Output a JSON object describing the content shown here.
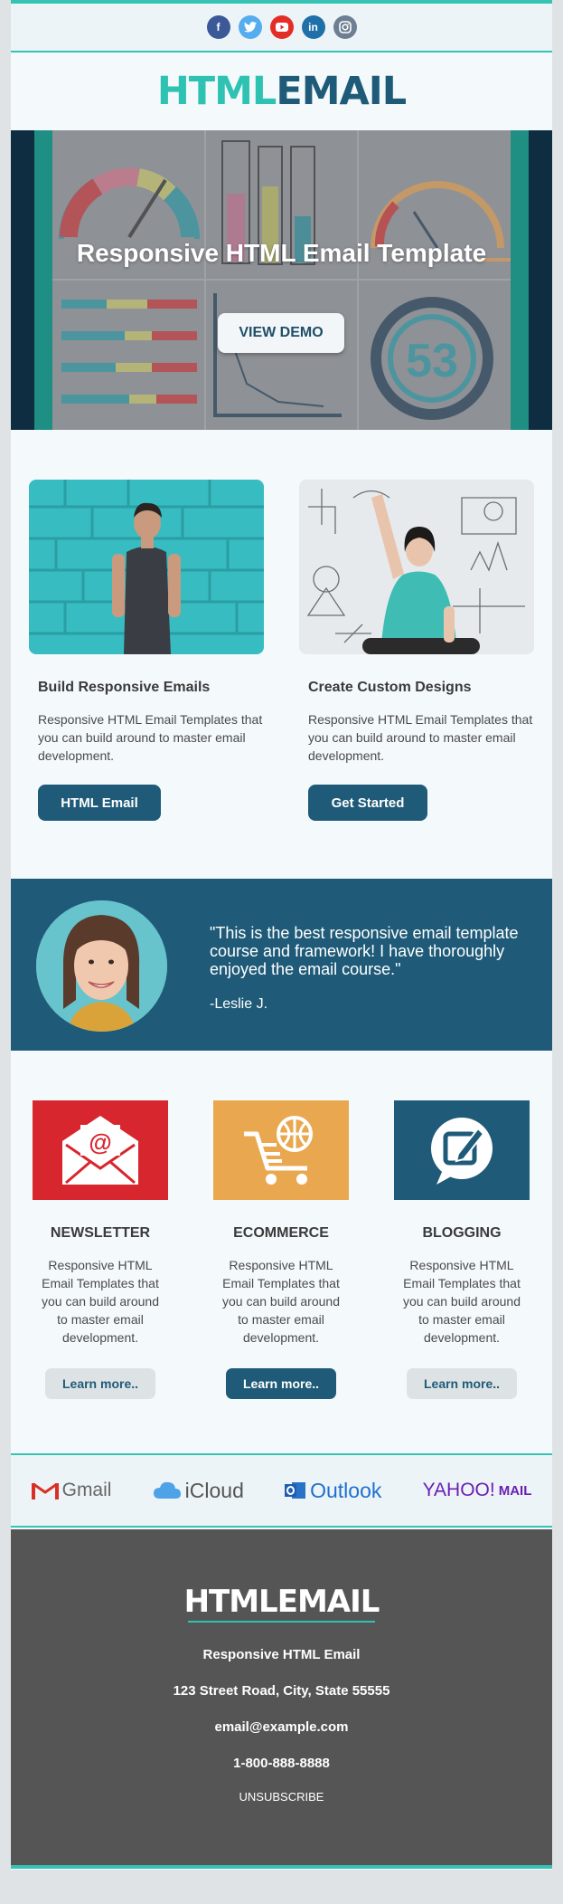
{
  "header": {
    "social": [
      {
        "name": "facebook-icon",
        "glyph": "f",
        "color": "#3b5998"
      },
      {
        "name": "twitter-icon",
        "glyph": "t",
        "color": "#55acee"
      },
      {
        "name": "youtube-icon",
        "glyph": "▶",
        "color": "#e52d27"
      },
      {
        "name": "linkedin-icon",
        "glyph": "in",
        "color": "#1f6fa8"
      },
      {
        "name": "instagram-icon",
        "glyph": "◎",
        "color": "#6d7f93"
      }
    ],
    "logo_part1": "HTML",
    "logo_part2": "EMAIL"
  },
  "hero": {
    "title": "Responsive HTML Email Template",
    "button": "VIEW DEMO",
    "gauge_number": "53"
  },
  "cards": [
    {
      "title": "Build Responsive Emails",
      "text": "Responsive HTML Email Templates that you can build around to master email development.",
      "button": "HTML Email"
    },
    {
      "title": "Create Custom Designs",
      "text": "Responsive HTML Email Templates that you can build around to master email development.",
      "button": "Get Started"
    }
  ],
  "testimonial": {
    "quote": "\"This is the best responsive email template course and framework! I have thoroughly enjoyed the email course.\"",
    "author": "-Leslie J."
  },
  "features": [
    {
      "title": "NEWSLETTER",
      "text": "Responsive HTML Email Templates that you can build around to master email development.",
      "button": "Learn more..",
      "color": "#d8262e",
      "icon": "envelope-at-icon"
    },
    {
      "title": "ECOMMERCE",
      "text": "Responsive HTML Email Templates that you can build around to master email development.",
      "button": "Learn more..",
      "color": "#e9a84f",
      "icon": "cart-globe-icon"
    },
    {
      "title": "BLOGGING",
      "text": "Responsive HTML Email Templates that you can build around to master email development.",
      "button": "Learn more..",
      "color": "#1f5b78",
      "icon": "speech-pencil-icon"
    }
  ],
  "clients": {
    "gmail": "Gmail",
    "icloud": "iCloud",
    "outlook": "Outlook",
    "yahoo": "YAHOO!",
    "yahoo_mail": "MAIL"
  },
  "footer": {
    "logo": "HTMLEMAIL",
    "company": "Responsive HTML Email",
    "address": "123 Street Road, City, State 55555",
    "email": "email@example.com",
    "phone": "1-800-888-8888",
    "unsubscribe": "UNSUBSCRIBE"
  },
  "colors": {
    "accent": "#36c3b4",
    "brand_dark": "#1f5b78",
    "footer_bg": "#555555"
  }
}
